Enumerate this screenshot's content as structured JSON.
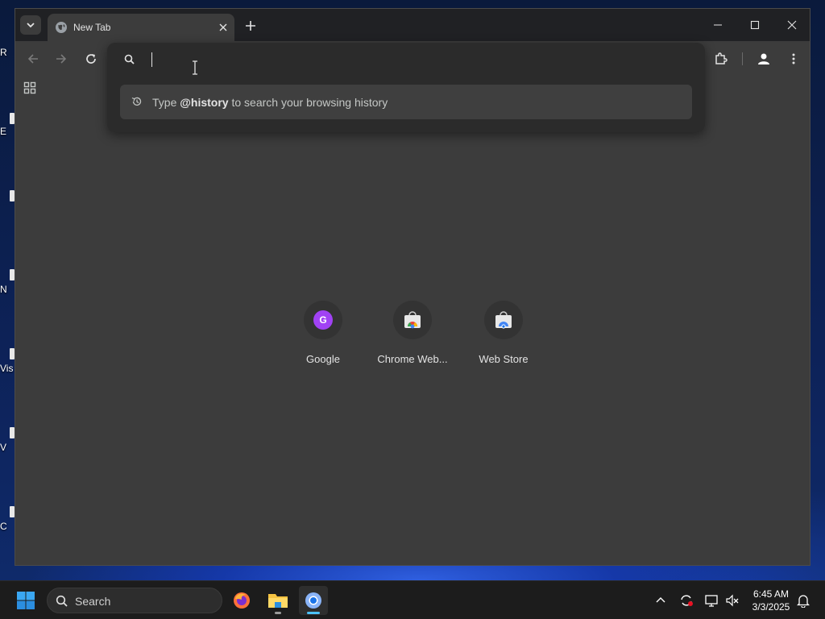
{
  "desktop": {
    "icon_labels": [
      "R",
      "E",
      "N",
      "Vis",
      "V",
      "C"
    ]
  },
  "browser": {
    "tab": {
      "title": "New Tab"
    },
    "omnibox": {
      "value": "",
      "suggestion": {
        "prefix": "Type",
        "keyword": "@history",
        "suffix": "to search your browsing history"
      }
    },
    "shortcuts": [
      {
        "label": "Google",
        "letter": "G"
      },
      {
        "label": "Chrome Web..."
      },
      {
        "label": "Web Store"
      }
    ]
  },
  "taskbar": {
    "search_label": "Search",
    "clock": {
      "time": "6:45 AM",
      "date": "3/3/2025"
    }
  },
  "colors": {
    "window_bg": "#3c3c3c",
    "titlebar_bg": "#202124",
    "popup_bg": "#2b2b2b",
    "google_avatar": "#a142f4",
    "taskbar_accent": "#4cc2ff"
  }
}
